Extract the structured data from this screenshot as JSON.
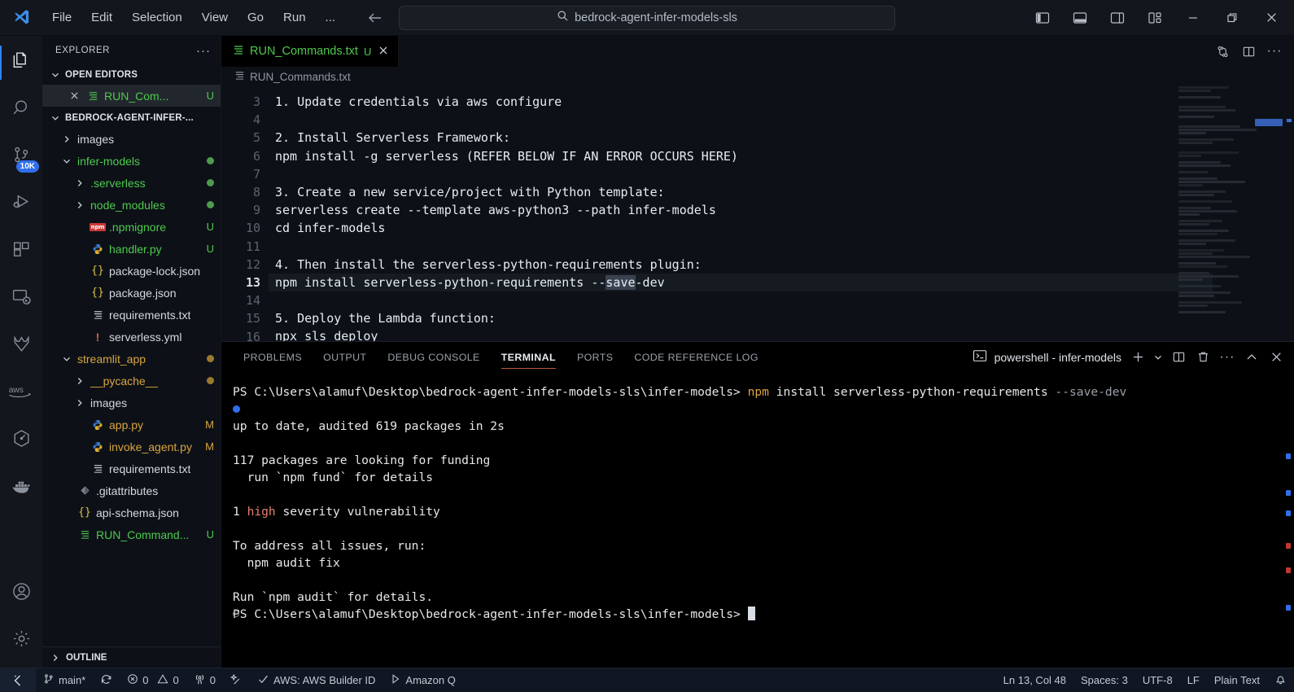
{
  "titlebar": {
    "logo_icon": "vscode-logo-icon",
    "menu": [
      "File",
      "Edit",
      "Selection",
      "View",
      "Go",
      "Run",
      "..."
    ],
    "nav_back_icon": "arrow-left-icon",
    "nav_forward_icon": "arrow-right-icon",
    "search": {
      "icon": "search-icon",
      "value": "bedrock-agent-infer-models-sls"
    },
    "layout_icons": [
      "toggle-primary-sidebar-icon",
      "toggle-panel-icon",
      "toggle-secondary-sidebar-icon",
      "customize-layout-icon"
    ],
    "window_controls": [
      "minimize-icon",
      "restore-icon",
      "close-icon"
    ]
  },
  "activitybar": {
    "items": [
      {
        "name": "explorer",
        "icon": "files-icon",
        "active": true
      },
      {
        "name": "search",
        "icon": "search-icon",
        "active": false
      },
      {
        "name": "source-control",
        "icon": "source-control-icon",
        "active": false,
        "badge": "10K"
      },
      {
        "name": "run-and-debug",
        "icon": "run-debug-icon",
        "active": false
      },
      {
        "name": "extensions",
        "icon": "extensions-icon",
        "active": false
      },
      {
        "name": "remote-explorer",
        "icon": "remote-explorer-icon",
        "active": false
      },
      {
        "name": "gitlab",
        "icon": "gitlab-icon",
        "active": false
      },
      {
        "name": "aws-toolkit",
        "icon": "aws-icon",
        "active": false
      },
      {
        "name": "package-manager",
        "icon": "hexagon-icon",
        "active": false
      },
      {
        "name": "docker",
        "icon": "docker-icon",
        "active": false
      }
    ],
    "bottom": [
      {
        "name": "accounts",
        "icon": "account-icon"
      },
      {
        "name": "manage",
        "icon": "gear-icon"
      }
    ]
  },
  "sidebar": {
    "title": "EXPLORER",
    "more_icon": "ellipsis-icon",
    "open_editors": {
      "label": "OPEN EDITORS",
      "items": [
        {
          "close_icon": "close-icon",
          "file_icon": "text-file-icon",
          "label": "RUN_Com...",
          "status": "U",
          "color": "#4ec94e",
          "selected": true
        }
      ]
    },
    "workspace": {
      "label": "BEDROCK-AGENT-INFER-...",
      "tree": [
        {
          "depth": 1,
          "twisty": "chevron-right",
          "icon": "folder-icon",
          "label": "images",
          "status": "",
          "dot": "",
          "color": "#d4d9e0"
        },
        {
          "depth": 1,
          "twisty": "chevron-down",
          "icon": "folder-icon",
          "label": "infer-models",
          "status": "",
          "dot": "#4e9a4e",
          "color": "#4ec94e"
        },
        {
          "depth": 2,
          "twisty": "chevron-right",
          "icon": "folder-icon",
          "label": ".serverless",
          "status": "",
          "dot": "#4e9a4e",
          "color": "#4ec94e"
        },
        {
          "depth": 2,
          "twisty": "chevron-right",
          "icon": "folder-icon",
          "label": "node_modules",
          "status": "",
          "dot": "#4e9a4e",
          "color": "#4ec94e"
        },
        {
          "depth": 2,
          "twisty": "",
          "icon": "npm-icon",
          "label": ".npmignore",
          "status": "U",
          "dot": "",
          "color": "#4ec94e"
        },
        {
          "depth": 2,
          "twisty": "",
          "icon": "python-icon",
          "label": "handler.py",
          "status": "U",
          "dot": "",
          "color": "#4ec94e"
        },
        {
          "depth": 2,
          "twisty": "",
          "icon": "json-icon",
          "label": "package-lock.json",
          "status": "",
          "dot": "",
          "color": "#d4d9e0"
        },
        {
          "depth": 2,
          "twisty": "",
          "icon": "json-icon",
          "label": "package.json",
          "status": "",
          "dot": "",
          "color": "#d4d9e0"
        },
        {
          "depth": 2,
          "twisty": "",
          "icon": "text-file-icon",
          "label": "requirements.txt",
          "status": "",
          "dot": "",
          "color": "#d4d9e0"
        },
        {
          "depth": 2,
          "twisty": "",
          "icon": "yaml-icon",
          "label": "serverless.yml",
          "status": "",
          "dot": "",
          "color": "#d4d9e0"
        },
        {
          "depth": 1,
          "twisty": "chevron-down",
          "icon": "folder-icon",
          "label": "streamlit_app",
          "status": "",
          "dot": "#9a7a2e",
          "color": "#d9a441"
        },
        {
          "depth": 2,
          "twisty": "chevron-right",
          "icon": "folder-icon",
          "label": "__pycache__",
          "status": "",
          "dot": "#9a7a2e",
          "color": "#d9a441"
        },
        {
          "depth": 2,
          "twisty": "chevron-right",
          "icon": "folder-icon",
          "label": "images",
          "status": "",
          "dot": "",
          "color": "#d4d9e0"
        },
        {
          "depth": 2,
          "twisty": "",
          "icon": "python-icon",
          "label": "app.py",
          "status": "M",
          "dot": "",
          "color": "#d9a441"
        },
        {
          "depth": 2,
          "twisty": "",
          "icon": "python-icon",
          "label": "invoke_agent.py",
          "status": "M",
          "dot": "",
          "color": "#d9a441"
        },
        {
          "depth": 2,
          "twisty": "",
          "icon": "text-file-icon",
          "label": "requirements.txt",
          "status": "",
          "dot": "",
          "color": "#d4d9e0"
        },
        {
          "depth": 1,
          "twisty": "",
          "icon": "git-icon",
          "label": ".gitattributes",
          "status": "",
          "dot": "",
          "color": "#d4d9e0"
        },
        {
          "depth": 1,
          "twisty": "",
          "icon": "json-icon",
          "label": "api-schema.json",
          "status": "",
          "dot": "",
          "color": "#d4d9e0"
        },
        {
          "depth": 1,
          "twisty": "",
          "icon": "text-file-icon",
          "label": "RUN_Command...",
          "status": "U",
          "dot": "",
          "color": "#4ec94e"
        }
      ]
    },
    "outline": {
      "label": "OUTLINE",
      "twisty": "chevron-right"
    }
  },
  "editor": {
    "tab": {
      "icon": "text-file-icon",
      "label": "RUN_Commands.txt",
      "status": "U",
      "close_icon": "close-icon"
    },
    "actions": [
      "split-diff-icon",
      "split-editor-icon",
      "more-actions-icon"
    ],
    "breadcrumb": {
      "icon": "text-file-icon",
      "label": "RUN_Commands.txt"
    },
    "first_line_number": 3,
    "current_line": 13,
    "lines": [
      {
        "n": 3,
        "text": "1. Update credentials via aws configure"
      },
      {
        "n": 4,
        "text": ""
      },
      {
        "n": 5,
        "text": "2. Install Serverless Framework:"
      },
      {
        "n": 6,
        "text": "npm install -g serverless (REFER BELOW IF AN ERROR OCCURS HERE)"
      },
      {
        "n": 7,
        "text": ""
      },
      {
        "n": 8,
        "text": "3. Create a new service/project with Python template:"
      },
      {
        "n": 9,
        "text": "serverless create --template aws-python3 --path infer-models"
      },
      {
        "n": 10,
        "text": "cd infer-models"
      },
      {
        "n": 11,
        "text": ""
      },
      {
        "n": 12,
        "text": "4. Then install the serverless-python-requirements plugin:"
      },
      {
        "n": 13,
        "text": "npm install serverless-python-requirements --save-dev",
        "current": true,
        "selection": "save"
      },
      {
        "n": 14,
        "text": ""
      },
      {
        "n": 15,
        "text": "5. Deploy the Lambda function:"
      },
      {
        "n": 16,
        "text": "npx sls deploy"
      }
    ]
  },
  "panel": {
    "tabs": [
      {
        "label": "PROBLEMS",
        "active": false
      },
      {
        "label": "OUTPUT",
        "active": false
      },
      {
        "label": "DEBUG CONSOLE",
        "active": false
      },
      {
        "label": "TERMINAL",
        "active": true
      },
      {
        "label": "PORTS",
        "active": false
      },
      {
        "label": "CODE REFERENCE LOG",
        "active": false
      }
    ],
    "terminal_name": {
      "icon": "powershell-icon",
      "label": "powershell - infer-models"
    },
    "actions": [
      "new-terminal-icon",
      "terminal-dropdown-icon",
      "split-terminal-icon",
      "kill-terminal-icon",
      "more-actions-icon",
      "maximize-panel-icon",
      "close-panel-icon"
    ],
    "terminal_lines": [
      {
        "marker": "none",
        "segments": [
          {
            "t": "PS C:\\Users\\alamuf\\Desktop\\bedrock-agent-infer-models-sls\\infer-models> ",
            "c": "#e8e8e8"
          },
          {
            "t": "npm",
            "c": "#d9a441"
          },
          {
            "t": " install serverless-python-requirements ",
            "c": "#e8e8e8"
          },
          {
            "t": "--save-dev",
            "c": "#9aa0a8"
          }
        ]
      },
      {
        "marker": "blue",
        "segments": []
      },
      {
        "marker": "none",
        "segments": [
          {
            "t": "up to date, audited 619 packages in 2s",
            "c": "#e8e8e8"
          }
        ]
      },
      {
        "marker": "none",
        "segments": []
      },
      {
        "marker": "none",
        "segments": [
          {
            "t": "117 packages are looking for funding",
            "c": "#e8e8e8"
          }
        ]
      },
      {
        "marker": "none",
        "segments": [
          {
            "t": "  run `npm fund` for details",
            "c": "#e8e8e8"
          }
        ]
      },
      {
        "marker": "none",
        "segments": []
      },
      {
        "marker": "none",
        "segments": [
          {
            "t": "1 ",
            "c": "#e8e8e8"
          },
          {
            "t": "high",
            "c": "#e9806e"
          },
          {
            "t": " severity vulnerability",
            "c": "#e8e8e8"
          }
        ]
      },
      {
        "marker": "none",
        "segments": []
      },
      {
        "marker": "none",
        "segments": [
          {
            "t": "To address all issues, run:",
            "c": "#e8e8e8"
          }
        ]
      },
      {
        "marker": "none",
        "segments": [
          {
            "t": "  npm audit fix",
            "c": "#e8e8e8"
          }
        ]
      },
      {
        "marker": "none",
        "segments": []
      },
      {
        "marker": "none",
        "segments": [
          {
            "t": "Run `npm audit` for details.",
            "c": "#e8e8e8"
          }
        ]
      },
      {
        "marker": "ring",
        "cursor": true,
        "segments": [
          {
            "t": "PS C:\\Users\\alamuf\\Desktop\\bedrock-agent-infer-models-sls\\infer-models> ",
            "c": "#e8e8e8"
          }
        ]
      }
    ]
  },
  "statusbar": {
    "remote_icon": "remote-indicator-icon",
    "left": [
      {
        "icon": "source-control-icon",
        "label": "main*",
        "name": "branch"
      },
      {
        "icon": "sync-icon",
        "label": "",
        "name": "sync-changes"
      },
      {
        "icon": "error-icon",
        "label": "0",
        "name": "errors"
      },
      {
        "icon": "warning-icon",
        "label": "0",
        "name": "warnings"
      },
      {
        "icon": "radio-tower-icon",
        "label": "0",
        "name": "ports"
      },
      {
        "icon": "sparkle-icon",
        "label": "",
        "name": "ai-suggestions"
      },
      {
        "icon": "check-icon",
        "label": "AWS: AWS Builder ID",
        "name": "aws-connection"
      },
      {
        "icon": "play-icon",
        "label": "Amazon Q",
        "name": "amazon-q"
      }
    ],
    "right": [
      {
        "label": "Ln 13, Col 48",
        "name": "cursor-position"
      },
      {
        "label": "Spaces: 3",
        "name": "indentation"
      },
      {
        "label": "UTF-8",
        "name": "encoding"
      },
      {
        "label": "LF",
        "name": "eol"
      },
      {
        "label": "Plain Text",
        "name": "language-mode"
      },
      {
        "icon": "bell-icon",
        "label": "",
        "name": "notifications"
      }
    ]
  },
  "colors": {
    "accent_blue": "#2f6fed",
    "git_added": "#4ec94e",
    "git_modified": "#d9a441",
    "panel_active_underline": "#bb593a"
  }
}
